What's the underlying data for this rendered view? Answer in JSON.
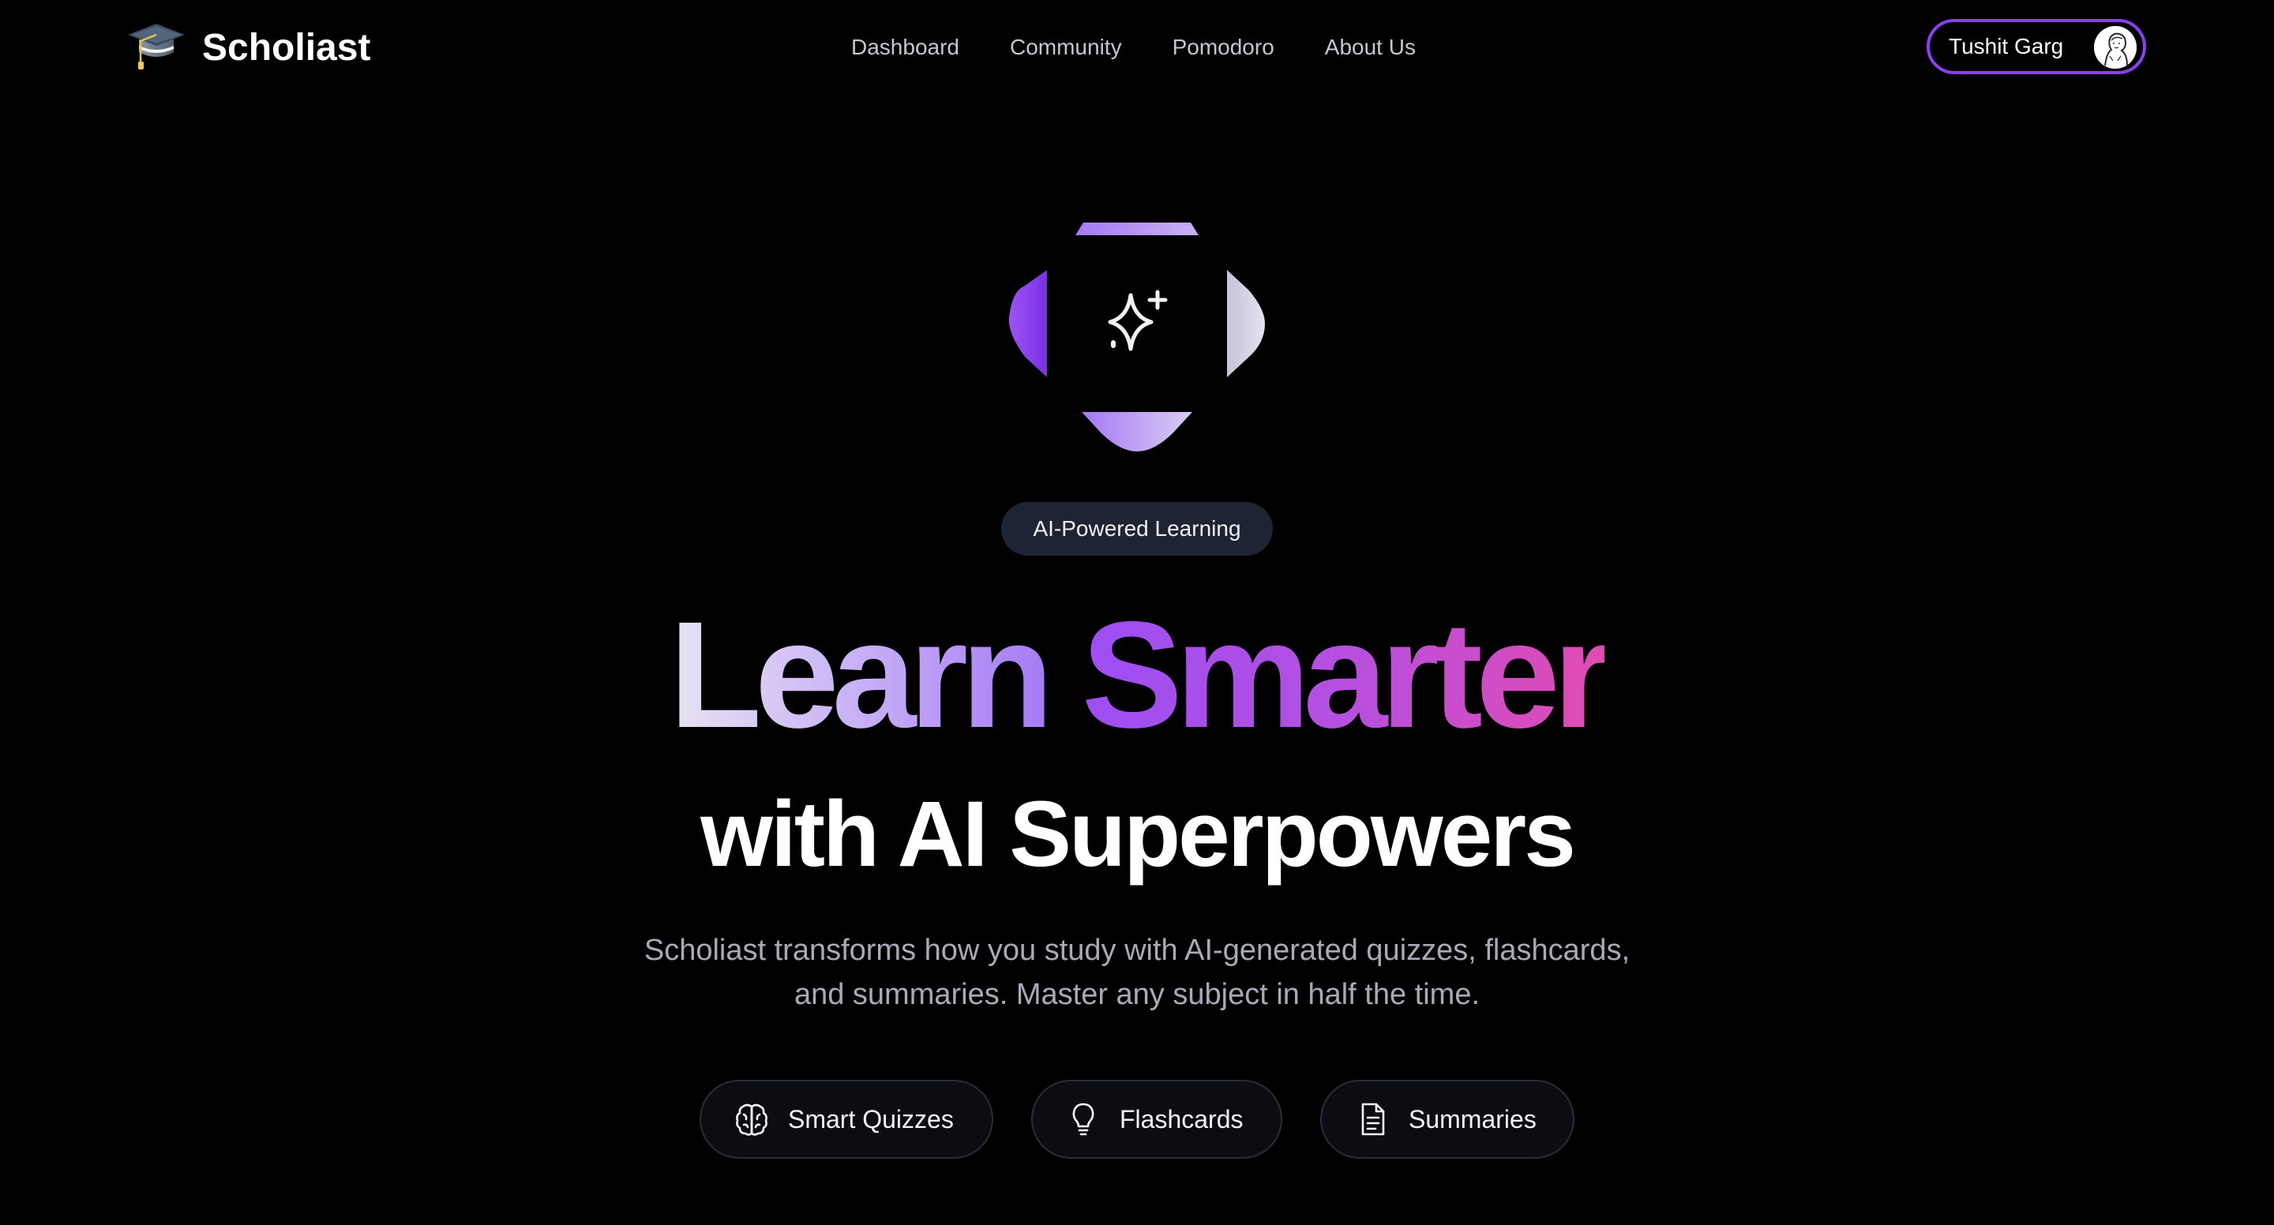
{
  "brand": {
    "name": "Scholiast",
    "logo_icon": "graduation-cap-icon"
  },
  "nav": {
    "links": [
      "Dashboard",
      "Community",
      "Pomodoro",
      "About Us"
    ]
  },
  "user": {
    "name": "Tushit Garg",
    "avatar_icon": "avatar-sketch"
  },
  "hero": {
    "icon": "sparkles-icon",
    "badge": "AI-Powered Learning",
    "headline_part1": "Learn",
    "headline_part2": "Smarter",
    "subheadline": "with AI Superpowers",
    "description_line1": "Scholiast transforms how you study with AI-generated quizzes, flashcards,",
    "description_line2": "and summaries. Master any subject in half the time."
  },
  "features": [
    {
      "label": "Smart Quizzes",
      "icon": "brain-icon"
    },
    {
      "label": "Flashcards",
      "icon": "lightbulb-icon"
    },
    {
      "label": "Summaries",
      "icon": "document-icon"
    }
  ],
  "colors": {
    "background": "#000000",
    "accent_purple": "#8b3ff2",
    "badge_background": "#1e2433",
    "gradient_start": "#e7e3f2",
    "gradient_mid": "#9d4ef4",
    "gradient_end": "#e24bb2"
  }
}
